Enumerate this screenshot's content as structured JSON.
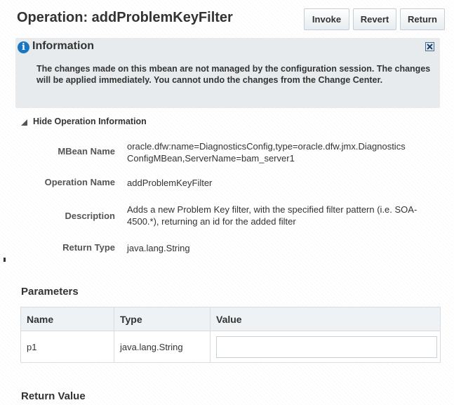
{
  "header": {
    "title": "Operation: addProblemKeyFilter",
    "buttons": {
      "invoke": "Invoke",
      "revert": "Revert",
      "return": "Return"
    }
  },
  "info": {
    "title": "Information",
    "message": "The changes made on this mbean are not managed by the configuration session. The changes will be applied immediately. You cannot undo the changes from the Change Center."
  },
  "operation_info": {
    "toggle_label": "Hide Operation Information",
    "fields": [
      {
        "label": "MBean Name",
        "value": "oracle.dfw:name=DiagnosticsConfig,type=oracle.dfw.jmx.DiagnosticsConfigMBean,ServerName=bam_server1"
      },
      {
        "label": "Operation Name",
        "value": "addProblemKeyFilter"
      },
      {
        "label": "Description",
        "value": "Adds a new Problem Key filter, with the specified filter pattern (i.e. SOA-4500.*), returning an id for the added filter"
      },
      {
        "label": "Return Type",
        "value": "java.lang.String"
      }
    ]
  },
  "parameters": {
    "heading": "Parameters",
    "columns": [
      "Name",
      "Type",
      "Value"
    ],
    "rows": [
      {
        "name": "p1",
        "type": "java.lang.String",
        "value": ""
      }
    ]
  },
  "return_value": {
    "heading": "Return Value"
  },
  "colors": {
    "info_icon": "#1a76c0",
    "info_bg": "#e8ebed",
    "table_header_bg": "#eef2f5"
  }
}
